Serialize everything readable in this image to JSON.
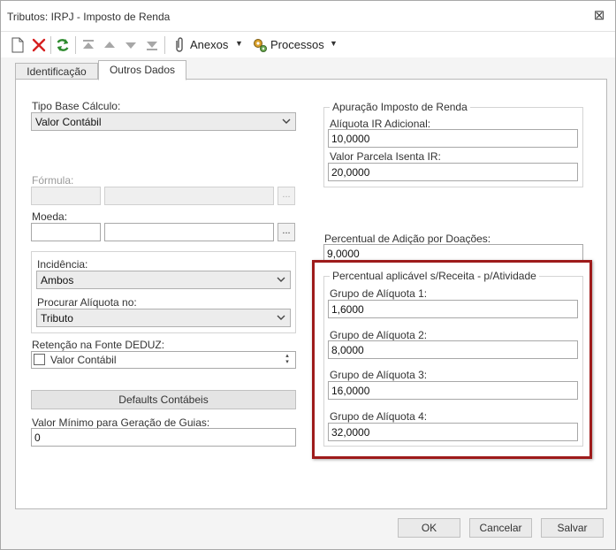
{
  "window": {
    "title": "Tributos: IRPJ - Imposto de Renda",
    "close_glyph": "⊠"
  },
  "toolbar": {
    "attachments_label": "Anexos",
    "processes_label": "Processos",
    "icons": [
      "new-icon",
      "delete-icon",
      "refresh-icon",
      "first-icon",
      "previous-icon",
      "next-icon",
      "last-icon",
      "paperclip-icon",
      "gears-icon"
    ]
  },
  "tabs": [
    {
      "label": "Identificação",
      "active": false
    },
    {
      "label": "Outros Dados",
      "active": true
    }
  ],
  "left": {
    "tipo_base_calculo": {
      "label": "Tipo Base Cálculo:",
      "value": "Valor Contábil"
    },
    "formula": {
      "label": "Fórmula:",
      "code": "",
      "description": ""
    },
    "moeda": {
      "label": "Moeda:",
      "code": "",
      "description": ""
    },
    "dots_label": "...",
    "incidencia": {
      "label": "Incidência:",
      "value": "Ambos"
    },
    "procurar_aliquota": {
      "label": "Procurar Alíquota no:",
      "value": "Tributo"
    },
    "retencao": {
      "label": "Retenção na Fonte DEDUZ:",
      "item": "Valor Contábil",
      "checked": false
    },
    "defaults_button": "Defaults Contábeis",
    "valor_minimo": {
      "label": "Valor Mínimo para Geração de Guias:",
      "value": "0"
    }
  },
  "right": {
    "apuracao": {
      "title": "Apuração Imposto de Renda",
      "aliquota_ir_label": "Alíquota IR Adicional:",
      "aliquota_ir_value": "10,0000",
      "valor_parcela_label": "Valor Parcela Isenta IR:",
      "valor_parcela_value": "20,0000"
    },
    "doacoes": {
      "label": "Percentual de Adição por Doações:",
      "value": "9,0000"
    },
    "percentual": {
      "title": "Percentual aplicável s/Receita - p/Atividade",
      "grupos": [
        {
          "label": "Grupo de Alíquota 1:",
          "value": "1,6000"
        },
        {
          "label": "Grupo de Alíquota 2:",
          "value": "8,0000"
        },
        {
          "label": "Grupo de Alíquota 3:",
          "value": "16,0000"
        },
        {
          "label": "Grupo de Alíquota 4:",
          "value": "32,0000"
        }
      ]
    }
  },
  "buttons": {
    "ok": "OK",
    "cancel": "Cancelar",
    "save": "Salvar"
  },
  "colors": {
    "highlight": "#9e1b1b",
    "accent_green": "#2e8b2e",
    "delete_red": "#d62020"
  }
}
